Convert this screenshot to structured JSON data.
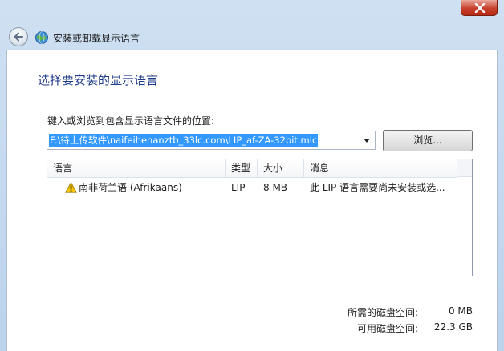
{
  "window": {
    "title": "安装或卸载显示语言"
  },
  "page": {
    "heading": "选择要安装的显示语言",
    "path_label": "键入或浏览到包含显示语言文件的位置:",
    "path_value": "F:\\待上传软件\\naifeihenanztb_33lc.com\\LIP_af-ZA-32bit.mlc",
    "browse_label": "浏览..."
  },
  "list": {
    "columns": [
      "语言",
      "类型",
      "大小",
      "消息"
    ],
    "rows": [
      {
        "language": "南非荷兰语 (Afrikaans)",
        "type": "LIP",
        "size": "8 MB",
        "message": "此 LIP 语言需要尚未安装或选..."
      }
    ]
  },
  "disk": {
    "required_label": "所需的磁盘空间:",
    "required_value": "0 MB",
    "available_label": "可用磁盘空间:",
    "available_value": "22.3 GB"
  },
  "colors": {
    "heading": "#1e3a8a",
    "selection": "#3399ff",
    "warning": "#f2c200"
  }
}
